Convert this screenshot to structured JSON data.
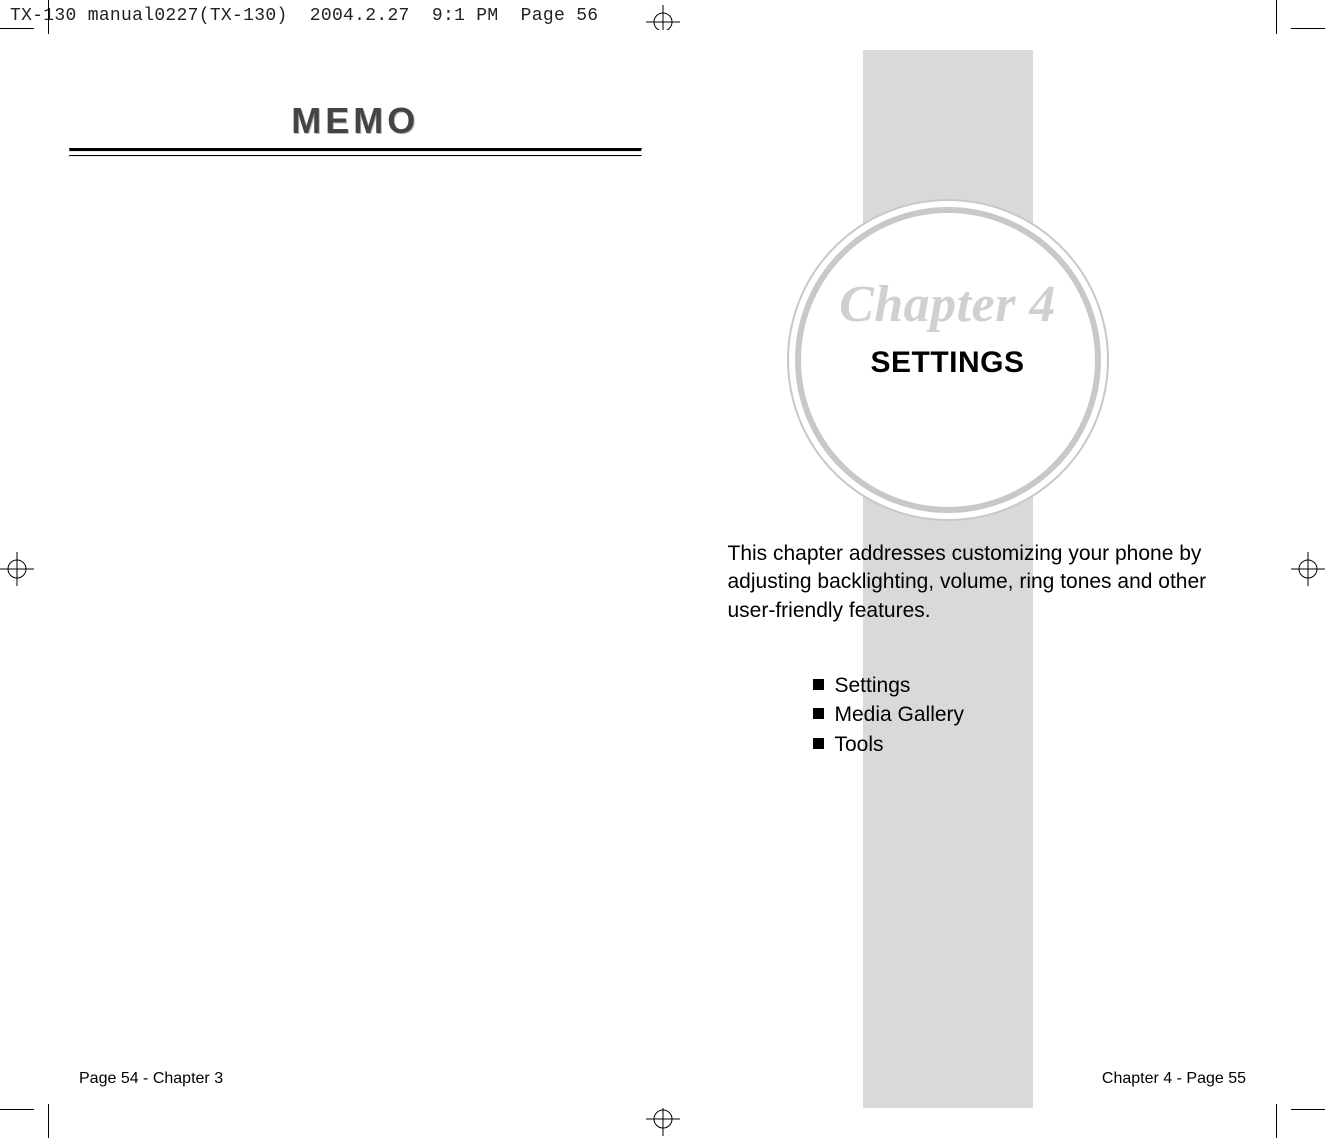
{
  "imposition_header": "TX-130 manual0227(TX-130)  2004.2.27  9:1 PM  Page 56",
  "left_page": {
    "memo_heading": "MEMO",
    "folio": "Page 54 - Chapter 3"
  },
  "right_page": {
    "chapter_label": "Chapter 4",
    "section_heading": "SETTINGS",
    "intro_paragraph": "This chapter addresses customizing your phone by adjusting backlighting, volume, ring tones and other user-friendly features.",
    "bullets": [
      "Settings",
      "Media Gallery",
      "Tools"
    ],
    "folio": "Chapter 4 - Page 55"
  }
}
